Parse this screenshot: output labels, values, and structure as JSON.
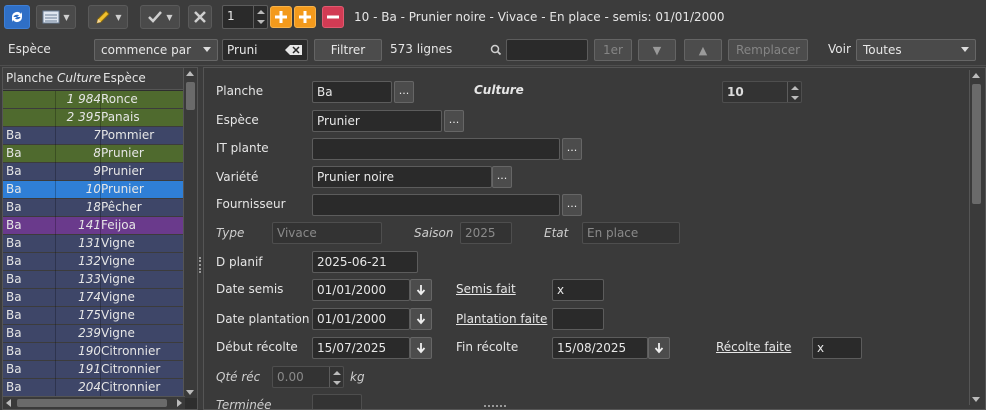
{
  "toolbar": {
    "spin_value": "1",
    "window_title": "10 - Ba - Prunier noire - Vivace - En place - semis: 01/01/2000"
  },
  "filterbar": {
    "field_label": "Espèce",
    "mode": "commence par",
    "filter_value": "Pruni",
    "filter_button": "Filtrer",
    "row_count": "573 lignes",
    "search_value": "",
    "first_button": "1er",
    "replace_button": "Remplacer",
    "view_label": "Voir",
    "view_value": "Toutes"
  },
  "table": {
    "headers": [
      "Planche",
      "Culture",
      "Espèce"
    ],
    "rows": [
      {
        "planche": "",
        "culture": "1 984",
        "espece": "Ronce",
        "color": "#4f6a2e"
      },
      {
        "planche": "",
        "culture": "2 395",
        "espece": "Panais",
        "color": "#4f6a2e"
      },
      {
        "planche": "Ba",
        "culture": "7",
        "espece": "Pommier",
        "color": "#3e4668"
      },
      {
        "planche": "Ba",
        "culture": "8",
        "espece": "Prunier",
        "color": "#4f6a2e"
      },
      {
        "planche": "Ba",
        "culture": "9",
        "espece": "Prunier",
        "color": "#3e4668"
      },
      {
        "planche": "Ba",
        "culture": "10",
        "espece": "Prunier",
        "color": "#2f7fd6"
      },
      {
        "planche": "Ba",
        "culture": "18",
        "espece": "Pêcher",
        "color": "#3e4668"
      },
      {
        "planche": "Ba",
        "culture": "141",
        "espece": "Feijoa",
        "color": "#6a3a8c"
      },
      {
        "planche": "Ba",
        "culture": "131",
        "espece": "Vigne",
        "color": "#3e4668"
      },
      {
        "planche": "Ba",
        "culture": "132",
        "espece": "Vigne",
        "color": "#3e4668"
      },
      {
        "planche": "Ba",
        "culture": "133",
        "espece": "Vigne",
        "color": "#3e4668"
      },
      {
        "planche": "Ba",
        "culture": "174",
        "espece": "Vigne",
        "color": "#3e4668"
      },
      {
        "planche": "Ba",
        "culture": "175",
        "espece": "Vigne",
        "color": "#3e4668"
      },
      {
        "planche": "Ba",
        "culture": "239",
        "espece": "Vigne",
        "color": "#3e4668"
      },
      {
        "planche": "Ba",
        "culture": "190",
        "espece": "Citronnier",
        "color": "#3e4668"
      },
      {
        "planche": "Ba",
        "culture": "191",
        "espece": "Citronnier",
        "color": "#3e4668"
      },
      {
        "planche": "Ba",
        "culture": "204",
        "espece": "Citronnier",
        "color": "#3e4668"
      }
    ]
  },
  "form": {
    "planche_label": "Planche",
    "planche_value": "Ba",
    "culture_label": "Culture",
    "culture_value": "10",
    "espece_label": "Espèce",
    "espece_value": "Prunier",
    "itplante_label": "IT plante",
    "itplante_value": "",
    "variete_label": "Variété",
    "variete_value": "Prunier noire",
    "fournisseur_label": "Fournisseur",
    "fournisseur_value": "",
    "type_label": "Type",
    "type_value": "Vivace",
    "saison_label": "Saison",
    "saison_value": "2025",
    "etat_label": "Etat",
    "etat_value": "En place",
    "dplanif_label": "D planif",
    "dplanif_value": "2025-06-21",
    "datesemis_label": "Date semis",
    "datesemis_value": "01/01/2000",
    "semisfait_label": "Semis fait",
    "semisfait_value": "x",
    "dateplantation_label": "Date plantation",
    "dateplantation_value": "01/01/2000",
    "plantationfaite_label": "Plantation faite",
    "plantationfaite_value": "",
    "debutrecolte_label": "Début récolte",
    "debutrecolte_value": "15/07/2025",
    "finrecolte_label": "Fin récolte",
    "finrecolte_value": "15/08/2025",
    "recoltefaite_label": "Récolte faite",
    "recoltefaite_value": "x",
    "qterec_label": "Qté réc",
    "qterec_value": "0.00",
    "qterec_unit": "kg",
    "terminee_label": "Terminée"
  },
  "colors": {
    "orange": "#f39a1c",
    "red": "#d23b54",
    "blue": "#2f7fd6",
    "dark": "#3c3c3c"
  }
}
